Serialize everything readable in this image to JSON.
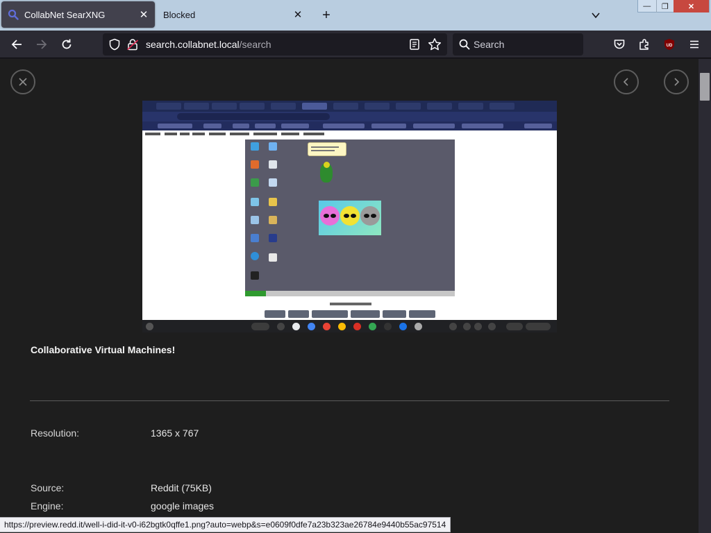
{
  "browser": {
    "tabs": [
      {
        "title": "CollabNet SearXNG",
        "active": true,
        "favicon": "search-magnifier-icon"
      },
      {
        "title": "Blocked",
        "active": false
      }
    ],
    "url_host": "search.collabnet.local",
    "url_path": "/search",
    "search_placeholder": "Search",
    "status_url": "https://preview.redd.it/well-i-did-it-v0-i62bgtk0qffe1.png?auto=webp&s=e0609f0dfe7a23b323ae26784e9440b55ac97514"
  },
  "detail": {
    "title": "Collaborative Virtual Machines!",
    "resolution_label": "Resolution:",
    "resolution_value": "1365 x 767",
    "source_label": "Source:",
    "source_value": "Reddit (75KB)",
    "engine_label": "Engine:",
    "engine_value": "google images"
  },
  "colors": {
    "accent": "#42414d",
    "page_background": "#1e1e1e",
    "tabstrip": "#b9cde0",
    "close_button": "#c7483f"
  }
}
